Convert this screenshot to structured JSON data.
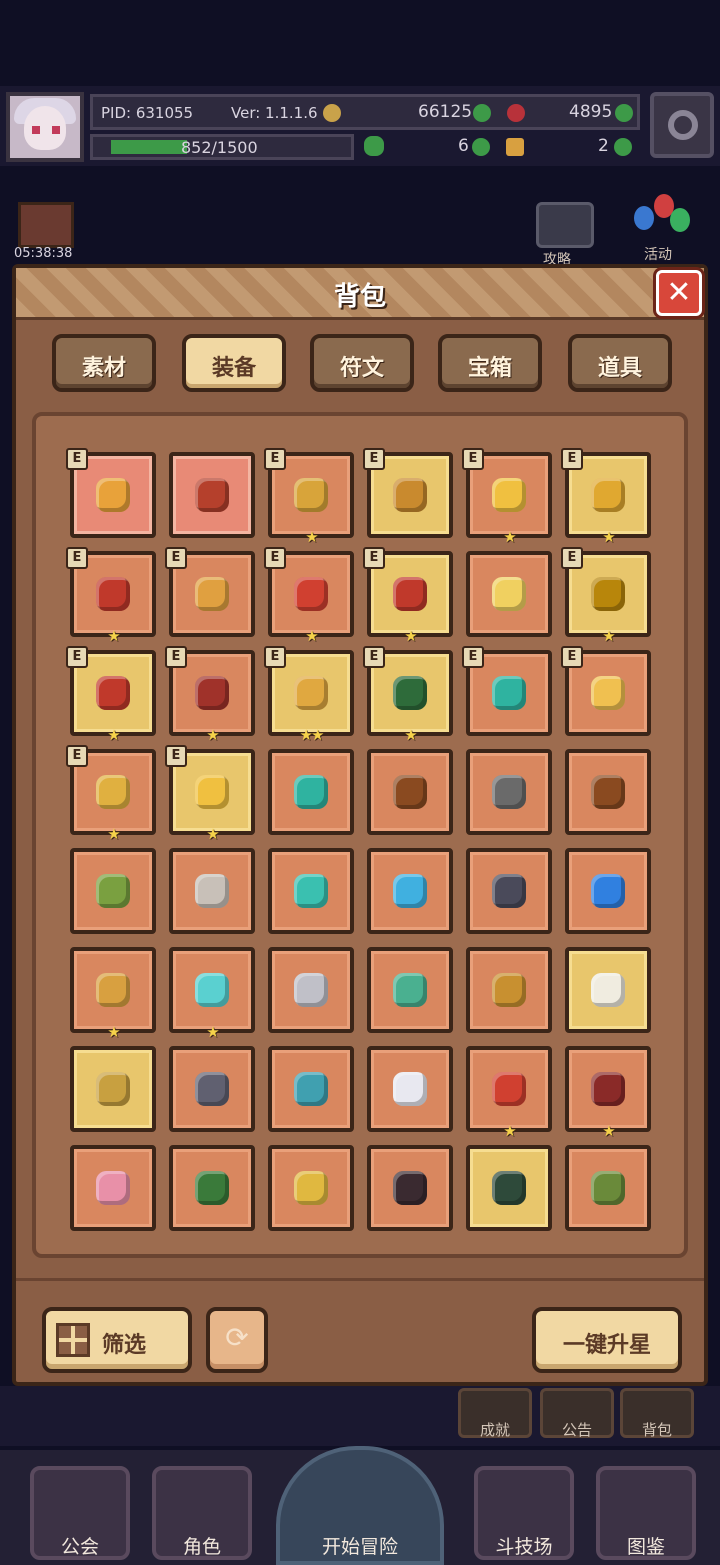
{
  "status": {
    "pid": "PID: 631055",
    "version": "Ver: 1.1.1.6",
    "gold": "66125",
    "gems": "4895",
    "exp": "852/1500",
    "clover": "6",
    "keys": "2",
    "timer": "05:38:38"
  },
  "background_labels": {
    "guide": "攻略",
    "event": "活动",
    "achievements": "成就",
    "notice": "公告",
    "bag": "背包"
  },
  "panel": {
    "title": "背包",
    "close": "✕",
    "tabs": [
      {
        "label": "素材"
      },
      {
        "label": "装备"
      },
      {
        "label": "符文"
      },
      {
        "label": "宝箱"
      },
      {
        "label": "道具"
      }
    ]
  },
  "grid": {
    "items": [
      {
        "name": "hat",
        "bg": "pink",
        "e": true,
        "stars": "",
        "color": "#e8a23a"
      },
      {
        "name": "cap",
        "bg": "pink",
        "e": false,
        "stars": "",
        "color": "#b5402c"
      },
      {
        "name": "mace",
        "bg": "orange",
        "e": true,
        "stars": "★",
        "color": "#d8a43a"
      },
      {
        "name": "scepter",
        "bg": "gold",
        "e": true,
        "stars": "",
        "color": "#c98a2e"
      },
      {
        "name": "helmet",
        "bg": "orange",
        "e": true,
        "stars": "★",
        "color": "#f0c040"
      },
      {
        "name": "ring",
        "bg": "gold",
        "e": true,
        "stars": "★",
        "color": "#e0a830"
      },
      {
        "name": "armor",
        "bg": "orange",
        "e": true,
        "stars": "★",
        "color": "#c0392b"
      },
      {
        "name": "wings-armor",
        "bg": "orange",
        "e": true,
        "stars": "",
        "color": "#e0a040"
      },
      {
        "name": "gauntlet",
        "bg": "orange",
        "e": true,
        "stars": "★",
        "color": "#d04030"
      },
      {
        "name": "glove",
        "bg": "gold",
        "e": true,
        "stars": "★",
        "color": "#c0392b"
      },
      {
        "name": "sun-ring",
        "bg": "orange",
        "e": false,
        "stars": "",
        "color": "#f0d060"
      },
      {
        "name": "crown-ring",
        "bg": "gold",
        "e": true,
        "stars": "★",
        "color": "#b8860b"
      },
      {
        "name": "collar",
        "bg": "gold",
        "e": true,
        "stars": "★",
        "color": "#c0392b"
      },
      {
        "name": "necklace",
        "bg": "orange",
        "e": true,
        "stars": "★",
        "color": "#a0322a"
      },
      {
        "name": "boots-gold",
        "bg": "gold",
        "e": true,
        "stars": "★★",
        "color": "#e0a840"
      },
      {
        "name": "boots-green",
        "bg": "gold",
        "e": true,
        "stars": "★",
        "color": "#2e6b3a"
      },
      {
        "name": "boots-teal",
        "bg": "orange",
        "e": true,
        "stars": "",
        "color": "#2fb3a0"
      },
      {
        "name": "amulet",
        "bg": "orange",
        "e": true,
        "stars": "",
        "color": "#f0c050"
      },
      {
        "name": "pendant",
        "bg": "orange",
        "e": true,
        "stars": "★",
        "color": "#e0b040"
      },
      {
        "name": "gem-ring",
        "bg": "gold",
        "e": true,
        "stars": "★",
        "color": "#f0c040"
      },
      {
        "name": "bow",
        "bg": "orange",
        "e": false,
        "stars": "",
        "color": "#2fb3a0"
      },
      {
        "name": "crossbow",
        "bg": "orange",
        "e": false,
        "stars": "",
        "color": "#8a4a20"
      },
      {
        "name": "iron-crossbow",
        "bg": "orange",
        "e": false,
        "stars": "",
        "color": "#6a6a6a"
      },
      {
        "name": "staff",
        "bg": "orange",
        "e": false,
        "stars": "",
        "color": "#8a4a20"
      },
      {
        "name": "green-mace",
        "bg": "orange",
        "e": false,
        "stars": "",
        "color": "#7aa040"
      },
      {
        "name": "axe",
        "bg": "orange",
        "e": false,
        "stars": "",
        "color": "#c8c0b8"
      },
      {
        "name": "ice-club",
        "bg": "orange",
        "e": false,
        "stars": "",
        "color": "#3ac0b0"
      },
      {
        "name": "ice-wand",
        "bg": "orange",
        "e": false,
        "stars": "",
        "color": "#40b0e0"
      },
      {
        "name": "dark-sword",
        "bg": "orange",
        "e": false,
        "stars": "",
        "color": "#4a4a5a"
      },
      {
        "name": "orb-staff",
        "bg": "orange",
        "e": false,
        "stars": "",
        "color": "#3080e0"
      },
      {
        "name": "arrow",
        "bg": "orange",
        "e": false,
        "stars": "★",
        "color": "#d8a040"
      },
      {
        "name": "orb",
        "bg": "orange",
        "e": false,
        "stars": "★",
        "color": "#5ad0d0"
      },
      {
        "name": "crossed-swords",
        "bg": "orange",
        "e": false,
        "stars": "",
        "color": "#c0c0c8"
      },
      {
        "name": "green-arrow",
        "bg": "orange",
        "e": false,
        "stars": "",
        "color": "#4ab090"
      },
      {
        "name": "spear",
        "bg": "orange",
        "e": false,
        "stars": "",
        "color": "#c89030"
      },
      {
        "name": "shield",
        "bg": "gold",
        "e": false,
        "stars": "",
        "color": "#f0ece0"
      },
      {
        "name": "quiver",
        "bg": "gold",
        "e": false,
        "stars": "",
        "color": "#c8a040"
      },
      {
        "name": "dagger",
        "bg": "orange",
        "e": false,
        "stars": "",
        "color": "#606070"
      },
      {
        "name": "lamp",
        "bg": "orange",
        "e": false,
        "stars": "",
        "color": "#40a0b0"
      },
      {
        "name": "pearl",
        "bg": "orange",
        "e": false,
        "stars": "",
        "color": "#e8e8f0"
      },
      {
        "name": "phoenix-cloak",
        "bg": "orange",
        "e": false,
        "stars": "★",
        "color": "#d04030"
      },
      {
        "name": "red-hood",
        "bg": "orange",
        "e": false,
        "stars": "★",
        "color": "#8a2a28"
      },
      {
        "name": "pink-hood",
        "bg": "orange",
        "e": false,
        "stars": "",
        "color": "#e890a8"
      },
      {
        "name": "green-hood",
        "bg": "orange",
        "e": false,
        "stars": "",
        "color": "#3a7a3a"
      },
      {
        "name": "crown",
        "bg": "orange",
        "e": false,
        "stars": "",
        "color": "#e0b840"
      },
      {
        "name": "cat-hood",
        "bg": "orange",
        "e": false,
        "stars": "",
        "color": "#3a2a30"
      },
      {
        "name": "dark-hood",
        "bg": "gold",
        "e": false,
        "stars": "",
        "color": "#2e4a3a"
      },
      {
        "name": "leaf-hood",
        "bg": "orange",
        "e": false,
        "stars": "",
        "color": "#6a8a3a"
      }
    ]
  },
  "actions": {
    "filter": "筛选",
    "refresh": "⟳",
    "upstar": "一键升星"
  },
  "nav": {
    "guild": "公会",
    "character": "角色",
    "adventure": "开始冒险",
    "arena": "斗技场",
    "codex": "图鉴"
  }
}
